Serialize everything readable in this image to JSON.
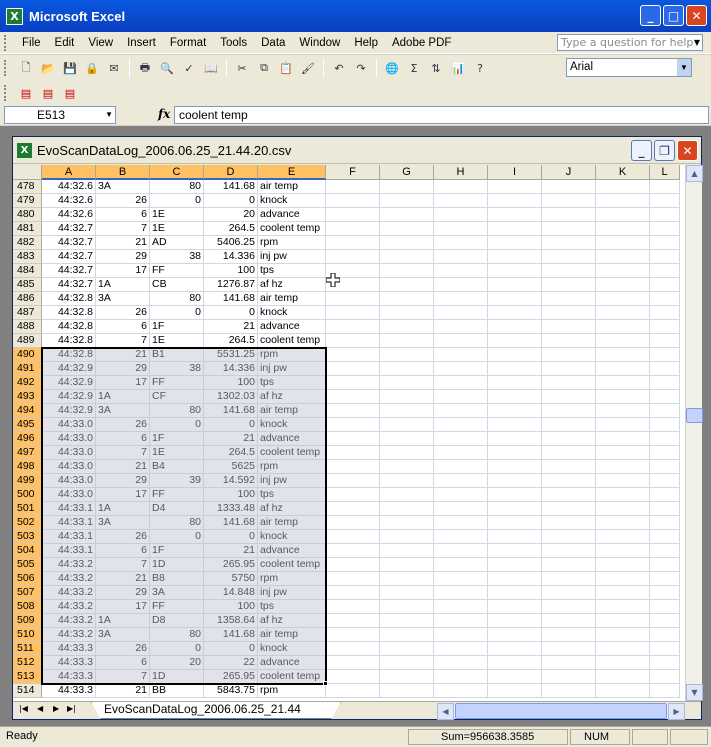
{
  "app": {
    "title": "Microsoft Excel"
  },
  "menu": [
    "File",
    "Edit",
    "View",
    "Insert",
    "Format",
    "Tools",
    "Data",
    "Window",
    "Help",
    "Adobe PDF"
  ],
  "help_placeholder": "Type a question for help",
  "font_name": "Arial",
  "name_box": "E513",
  "fx_label": "fx",
  "formula_value": "coolent temp",
  "workbook": {
    "title": "EvoScanDataLog_2006.06.25_21.44.20.csv"
  },
  "columns": [
    "A",
    "B",
    "C",
    "D",
    "E",
    "F",
    "G",
    "H",
    "I",
    "J",
    "K",
    "L"
  ],
  "rows": [
    [
      "478",
      "44:32.6",
      "3A",
      "80",
      "141.68",
      "air temp"
    ],
    [
      "479",
      "44:32.6",
      "26",
      "0",
      "0",
      "knock"
    ],
    [
      "480",
      "44:32.6",
      "6",
      "1E",
      "20",
      "advance"
    ],
    [
      "481",
      "44:32.7",
      "7",
      "1E",
      "264.5",
      "coolent temp"
    ],
    [
      "482",
      "44:32.7",
      "21",
      "AD",
      "5406.25",
      "rpm"
    ],
    [
      "483",
      "44:32.7",
      "29",
      "38",
      "14.336",
      "inj pw"
    ],
    [
      "484",
      "44:32.7",
      "17",
      "FF",
      "100",
      "tps"
    ],
    [
      "485",
      "44:32.7",
      "1A",
      "CB",
      "1276.87",
      "af hz"
    ],
    [
      "486",
      "44:32.8",
      "3A",
      "80",
      "141.68",
      "air temp"
    ],
    [
      "487",
      "44:32.8",
      "26",
      "0",
      "0",
      "knock"
    ],
    [
      "488",
      "44:32.8",
      "6",
      "1F",
      "21",
      "advance"
    ],
    [
      "489",
      "44:32.8",
      "7",
      "1E",
      "264.5",
      "coolent temp"
    ],
    [
      "490",
      "44:32.8",
      "21",
      "B1",
      "5531.25",
      "rpm"
    ],
    [
      "491",
      "44:32.9",
      "29",
      "38",
      "14.336",
      "inj pw"
    ],
    [
      "492",
      "44:32.9",
      "17",
      "FF",
      "100",
      "tps"
    ],
    [
      "493",
      "44:32.9",
      "1A",
      "CF",
      "1302.03",
      "af hz"
    ],
    [
      "494",
      "44:32.9",
      "3A",
      "80",
      "141.68",
      "air temp"
    ],
    [
      "495",
      "44:33.0",
      "26",
      "0",
      "0",
      "knock"
    ],
    [
      "496",
      "44:33.0",
      "6",
      "1F",
      "21",
      "advance"
    ],
    [
      "497",
      "44:33.0",
      "7",
      "1E",
      "264.5",
      "coolent temp"
    ],
    [
      "498",
      "44:33.0",
      "21",
      "B4",
      "5625",
      "rpm"
    ],
    [
      "499",
      "44:33.0",
      "29",
      "39",
      "14.592",
      "inj pw"
    ],
    [
      "500",
      "44:33.0",
      "17",
      "FF",
      "100",
      "tps"
    ],
    [
      "501",
      "44:33.1",
      "1A",
      "D4",
      "1333.48",
      "af hz"
    ],
    [
      "502",
      "44:33.1",
      "3A",
      "80",
      "141.68",
      "air temp"
    ],
    [
      "503",
      "44:33.1",
      "26",
      "0",
      "0",
      "knock"
    ],
    [
      "504",
      "44:33.1",
      "6",
      "1F",
      "21",
      "advance"
    ],
    [
      "505",
      "44:33.2",
      "7",
      "1D",
      "265.95",
      "coolent temp"
    ],
    [
      "506",
      "44:33.2",
      "21",
      "B8",
      "5750",
      "rpm"
    ],
    [
      "507",
      "44:33.2",
      "29",
      "3A",
      "14.848",
      "inj pw"
    ],
    [
      "508",
      "44:33.2",
      "17",
      "FF",
      "100",
      "tps"
    ],
    [
      "509",
      "44:33.2",
      "1A",
      "D8",
      "1358.64",
      "af hz"
    ],
    [
      "510",
      "44:33.2",
      "3A",
      "80",
      "141.68",
      "air temp"
    ],
    [
      "511",
      "44:33.3",
      "26",
      "0",
      "0",
      "knock"
    ],
    [
      "512",
      "44:33.3",
      "6",
      "20",
      "22",
      "advance"
    ],
    [
      "513",
      "44:33.3",
      "7",
      "1D",
      "265.95",
      "coolent temp"
    ],
    [
      "514",
      "44:33.3",
      "21",
      "BB",
      "5843.75",
      "rpm"
    ]
  ],
  "selection": {
    "first_row": "490",
    "last_row": "513",
    "active_cell": "E513"
  },
  "sheet_tab": "EvoScanDataLog_2006.06.25_21.44",
  "status": {
    "ready": "Ready",
    "sum": "Sum=956638.3585",
    "num": "NUM"
  }
}
